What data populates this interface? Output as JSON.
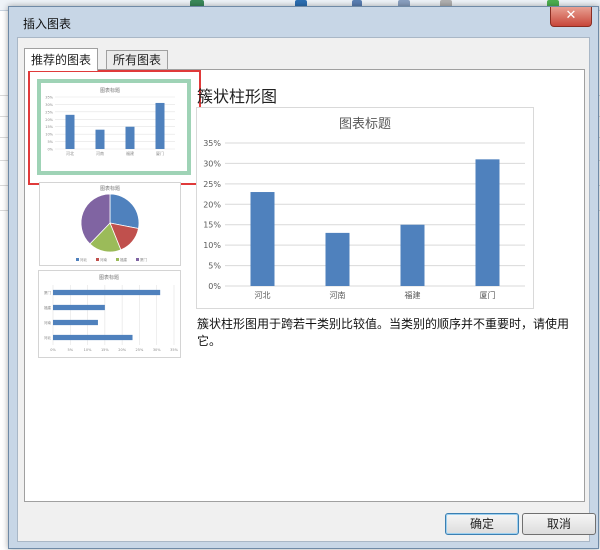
{
  "dialog": {
    "title": "插入图表",
    "close_label": "✕"
  },
  "tabs": [
    {
      "label": "推荐的图表",
      "active": true
    },
    {
      "label": "所有图表",
      "active": false
    }
  ],
  "thumbnails": [
    {
      "name": "clustered-column",
      "title": "图表标题",
      "categories": [
        "河北",
        "河南",
        "福建",
        "厦门"
      ],
      "values": [
        23,
        13,
        15,
        31
      ]
    },
    {
      "name": "pie",
      "title": "图表标题",
      "legend": [
        "河北",
        "河南",
        "福建",
        "厦门"
      ]
    },
    {
      "name": "clustered-bar",
      "title": "图表标题",
      "categories": [
        "厦门",
        "福建",
        "河南",
        "河北"
      ],
      "values": [
        31,
        15,
        13,
        23
      ],
      "xticks": [
        "0%",
        "5%",
        "10%",
        "15%",
        "20%",
        "25%",
        "30%",
        "35%"
      ]
    }
  ],
  "preview": {
    "type_title": "簇状柱形图",
    "description": "簇状柱形图用于跨若干类别比较值。当类别的顺序并不重要时，请使用它。"
  },
  "chart_data": {
    "type": "bar",
    "title": "图表标题",
    "categories": [
      "河北",
      "河南",
      "福建",
      "厦门"
    ],
    "values": [
      23,
      13,
      15,
      31
    ],
    "yticks": [
      "0%",
      "5%",
      "10%",
      "15%",
      "20%",
      "25%",
      "30%",
      "35%"
    ],
    "ylim": [
      0,
      35
    ],
    "grid": true,
    "color": "#4f81bd"
  },
  "buttons": {
    "ok_label": "确定",
    "cancel_label": "取消"
  },
  "colors": {
    "accent_selection": "#e03a3a",
    "bar": "#4f81bd",
    "pie": [
      "#4f81bd",
      "#c0504d",
      "#9bbb59",
      "#8064a2"
    ]
  }
}
